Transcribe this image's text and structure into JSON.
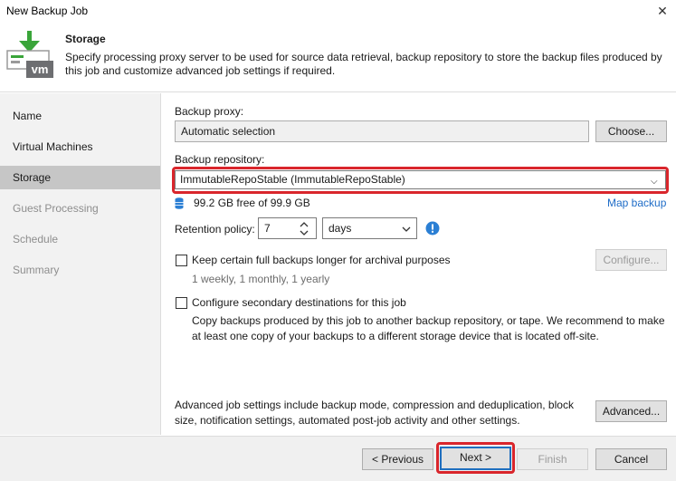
{
  "window": {
    "title": "New Backup Job"
  },
  "header": {
    "title": "Storage",
    "description": "Specify processing proxy server to be used for source data retrieval, backup repository to store the backup files produced by this job and customize advanced job settings if required.",
    "logo_text": "vm"
  },
  "sidebar": {
    "items": [
      {
        "label": "Name"
      },
      {
        "label": "Virtual Machines"
      },
      {
        "label": "Storage"
      },
      {
        "label": "Guest Processing"
      },
      {
        "label": "Schedule"
      },
      {
        "label": "Summary"
      }
    ]
  },
  "proxy": {
    "label": "Backup proxy:",
    "value": "Automatic selection",
    "choose_button": "Choose..."
  },
  "repository": {
    "label": "Backup repository:",
    "value": "ImmutableRepoStable (ImmutableRepoStable)",
    "free_space": "99.2 GB free of 99.9 GB",
    "map_backup": "Map backup"
  },
  "retention": {
    "label": "Retention policy:",
    "value": "7",
    "unit": "days"
  },
  "archival": {
    "label": "Keep certain full backups longer for archival purposes",
    "detail": "1 weekly, 1 monthly, 1 yearly",
    "configure_button": "Configure...",
    "checked": false
  },
  "secondary": {
    "label": "Configure secondary destinations for this job",
    "description": "Copy backups produced by this job to another backup repository, or tape. We recommend to make at least one copy of your backups to a different storage device that is located off-site.",
    "checked": false
  },
  "advanced": {
    "description": "Advanced job settings include backup mode, compression and deduplication, block size, notification settings, automated post-job activity and other settings.",
    "button": "Advanced..."
  },
  "footer": {
    "previous": "< Previous",
    "next": "Next >",
    "finish": "Finish",
    "cancel": "Cancel"
  },
  "colors": {
    "accent": "#1e6cc7",
    "highlight_box": "#d9262c",
    "logo_green": "#3aa53a",
    "logo_gray": "#6d6e71",
    "info_blue": "#2b7fd4"
  }
}
